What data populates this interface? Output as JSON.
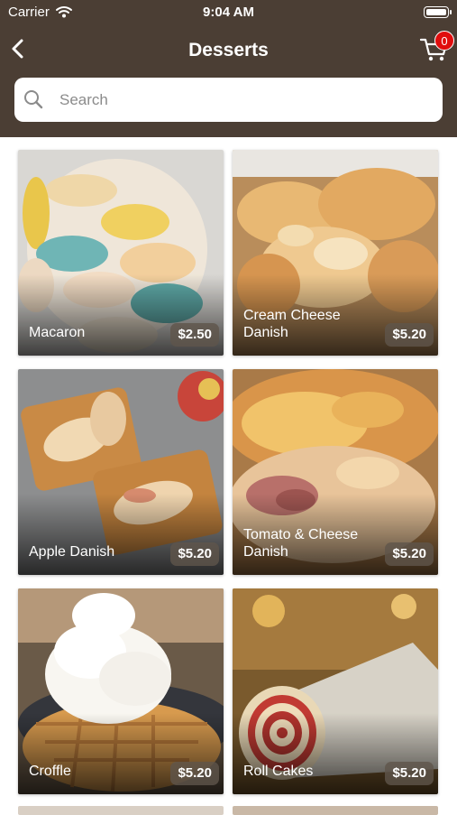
{
  "status_bar": {
    "carrier": "Carrier",
    "time": "9:04 AM"
  },
  "nav": {
    "title": "Desserts",
    "cart_count": "0"
  },
  "search": {
    "placeholder": "Search",
    "value": ""
  },
  "products": [
    {
      "name": "Macaron",
      "price": "$2.50"
    },
    {
      "name": "Cream Cheese Danish",
      "price": "$5.20"
    },
    {
      "name": "Apple Danish",
      "price": "$5.20"
    },
    {
      "name": "Tomato & Cheese Danish",
      "price": "$5.20"
    },
    {
      "name": "Croffle",
      "price": "$5.20"
    },
    {
      "name": "Roll Cakes",
      "price": "$5.20"
    }
  ],
  "icons": {
    "back": "chevron-left-icon",
    "cart": "cart-icon",
    "search": "search-icon",
    "wifi": "wifi-icon",
    "battery": "battery-icon"
  },
  "colors": {
    "header": "#4b3e34",
    "badge": "#e00d0d",
    "price_tag": "#5f554b"
  }
}
